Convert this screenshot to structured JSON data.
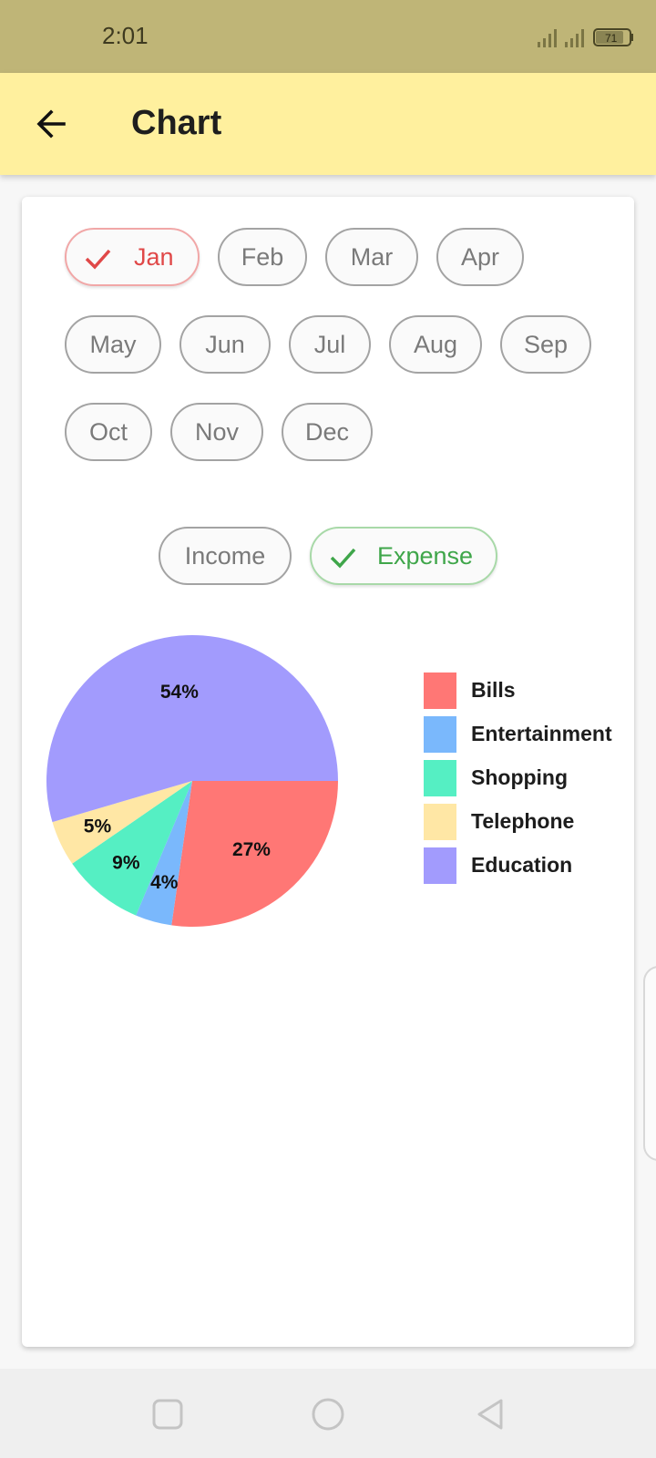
{
  "status_bar": {
    "time": "2:01",
    "battery": "71",
    "icons": [
      "signal-icon",
      "signal-icon",
      "battery-icon"
    ]
  },
  "app_bar": {
    "title": "Chart",
    "back_icon": "arrow-back-icon"
  },
  "months": {
    "selected": "Jan",
    "items": [
      "Jan",
      "Feb",
      "Mar",
      "Apr",
      "May",
      "Jun",
      "Jul",
      "Aug",
      "Sep",
      "Oct",
      "Nov",
      "Dec"
    ]
  },
  "type_filter": {
    "selected": "Expense",
    "items": [
      "Income",
      "Expense"
    ]
  },
  "colors": {
    "selected_month": "#e04848",
    "selected_type": "#3fa64a",
    "app_bar": "#fff09e",
    "status_bar": "#bfb577"
  },
  "chart_data": {
    "type": "pie",
    "labels": [
      "Bills",
      "Entertainment",
      "Shopping",
      "Telephone",
      "Education"
    ],
    "values": [
      27,
      4,
      9,
      5,
      54
    ],
    "value_labels": [
      "27%",
      "4%",
      "9%",
      "5%",
      "54%"
    ],
    "colors": [
      "#ff7775",
      "#7ab8fc",
      "#55efc3",
      "#ffe7a5",
      "#a29bfd"
    ],
    "legend_position": "right"
  },
  "nav_bar": {
    "icons": [
      "square-icon",
      "circle-icon",
      "triangle-back-icon"
    ]
  }
}
